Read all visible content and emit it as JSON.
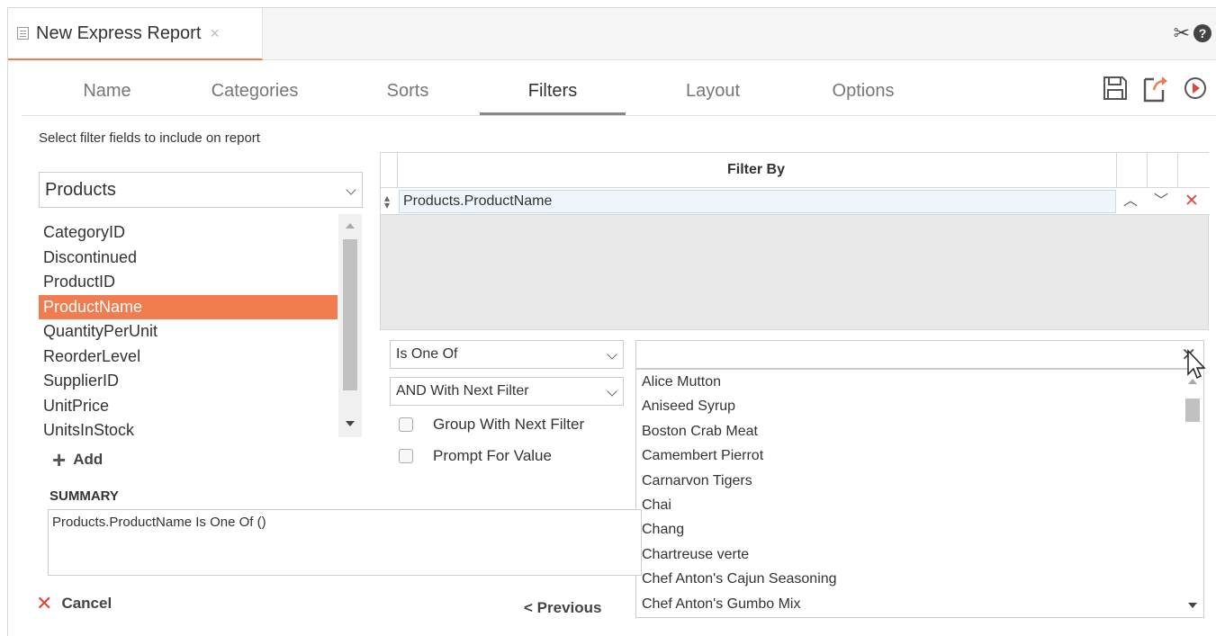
{
  "title_bar": {
    "title": "New Express Report",
    "close_glyph": "×",
    "icons": [
      "tools-icon",
      "help-icon"
    ]
  },
  "tabs": [
    {
      "label": "Name"
    },
    {
      "label": "Categories"
    },
    {
      "label": "Sorts"
    },
    {
      "label": "Filters",
      "active": true
    },
    {
      "label": "Layout"
    },
    {
      "label": "Options"
    }
  ],
  "actions": [
    "save-icon",
    "export-icon",
    "run-icon"
  ],
  "left_panel": {
    "hint": "Select filter fields to include on report",
    "table_select": "Products",
    "fields": [
      "CategoryID",
      "Discontinued",
      "ProductID",
      "ProductName",
      "QuantityPerUnit",
      "ReorderLevel",
      "SupplierID",
      "UnitPrice",
      "UnitsInStock"
    ],
    "selected_field": "ProductName",
    "add_label": "Add"
  },
  "filter_grid": {
    "header": "Filter By",
    "rows": [
      {
        "field": "Products.ProductName"
      }
    ]
  },
  "filter_options": {
    "operator": "Is One Of",
    "conjunction": "AND With Next Filter",
    "group_label": "Group With Next Filter",
    "prompt_label": "Prompt For Value"
  },
  "value_picker": {
    "value": "",
    "clear_glyph": "✕",
    "options": [
      "Alice Mutton",
      "Aniseed Syrup",
      "Boston Crab Meat",
      "Camembert Pierrot",
      "Carnarvon Tigers",
      "Chai",
      "Chang",
      "Chartreuse verte",
      "Chef Anton's Cajun Seasoning",
      "Chef Anton's Gumbo Mix"
    ]
  },
  "summary": {
    "label": "SUMMARY",
    "text": "Products.ProductName Is One Of ()"
  },
  "footer": {
    "cancel_label": "Cancel",
    "previous_label": "Previous"
  },
  "colors": {
    "accent": "#f07c4f",
    "delete": "#e0473b"
  }
}
